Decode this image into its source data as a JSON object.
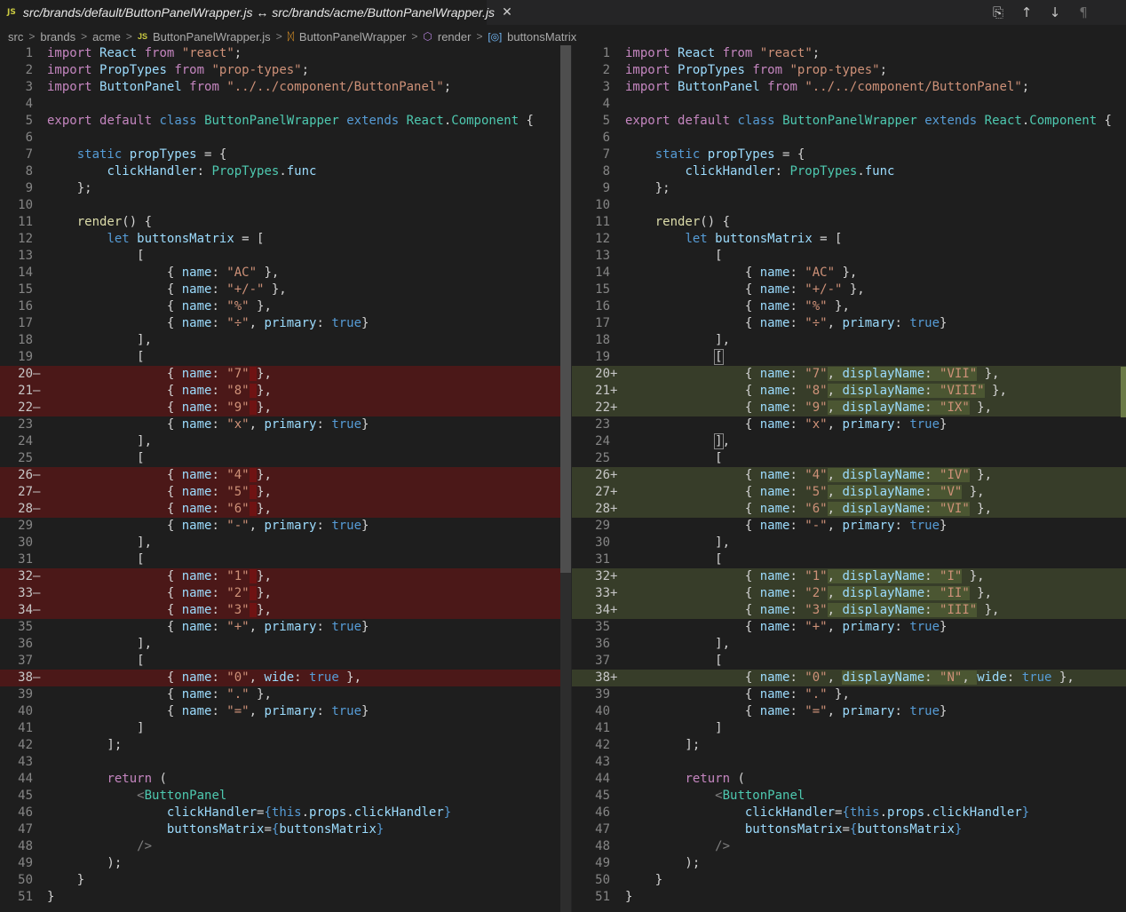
{
  "tab": {
    "badge": "JS",
    "title": "src/brands/default/ButtonPanelWrapper.js ↔ src/brands/acme/ButtonPanelWrapper.js",
    "close": "✕"
  },
  "actions": [
    {
      "name": "open-file-icon",
      "glyph": "⎘"
    },
    {
      "name": "previous-change-icon",
      "glyph": "↑"
    },
    {
      "name": "next-change-icon",
      "glyph": "↓"
    },
    {
      "name": "toggle-whitespace-icon",
      "glyph": "¶"
    },
    {
      "name": "more-actions-icon",
      "glyph": ""
    }
  ],
  "breadcrumb": {
    "src": "src",
    "brands": "brands",
    "acme": "acme",
    "file_badge": "JS",
    "file": "ButtonPanelWrapper.js",
    "class": "ButtonPanelWrapper",
    "method": "render",
    "variable": "buttonsMatrix",
    "sep": ">"
  },
  "left_lines": [
    {
      "n": "1",
      "m": "",
      "t": "",
      "h": "<span class='k'>import</span> <span class='v'>React</span> <span class='k'>from</span> <span class='s'>\"react\"</span>;"
    },
    {
      "n": "2",
      "m": "",
      "t": "",
      "h": "<span class='k'>import</span> <span class='v'>PropTypes</span> <span class='k'>from</span> <span class='s'>\"prop-types\"</span>;"
    },
    {
      "n": "3",
      "m": "",
      "t": "",
      "h": "<span class='k'>import</span> <span class='v'>ButtonPanel</span> <span class='k'>from</span> <span class='s'>\"../../component/ButtonPanel\"</span>;"
    },
    {
      "n": "4",
      "m": "",
      "t": "",
      "h": ""
    },
    {
      "n": "5",
      "m": "",
      "t": "",
      "h": "<span class='k'>export</span> <span class='k'>default</span> <span class='kb'>class</span> <span class='t'>ButtonPanelWrapper</span> <span class='kb'>extends</span> <span class='t'>React</span>.<span class='t'>Component</span> {"
    },
    {
      "n": "6",
      "m": "",
      "t": "",
      "h": ""
    },
    {
      "n": "7",
      "m": "",
      "t": "",
      "h": "    <span class='kb'>static</span> <span class='p'>propTypes</span> = {"
    },
    {
      "n": "8",
      "m": "",
      "t": "",
      "h": "        <span class='p'>clickHandler</span>: <span class='t'>PropTypes</span>.<span class='p'>func</span>"
    },
    {
      "n": "9",
      "m": "",
      "t": "",
      "h": "    };"
    },
    {
      "n": "10",
      "m": "",
      "t": "",
      "h": ""
    },
    {
      "n": "11",
      "m": "",
      "t": "",
      "h": "    <span class='f'>render</span>() {"
    },
    {
      "n": "12",
      "m": "",
      "t": "",
      "h": "        <span class='kb'>let</span> <span class='v'>buttonsMatrix</span> = ["
    },
    {
      "n": "13",
      "m": "",
      "t": "",
      "h": "            ["
    },
    {
      "n": "14",
      "m": "",
      "t": "",
      "h": "                { <span class='p'>name</span>: <span class='s'>\"AC\"</span> },"
    },
    {
      "n": "15",
      "m": "",
      "t": "",
      "h": "                { <span class='p'>name</span>: <span class='s'>\"+/-\"</span> },"
    },
    {
      "n": "16",
      "m": "",
      "t": "",
      "h": "                { <span class='p'>name</span>: <span class='s'>\"%\"</span> },"
    },
    {
      "n": "17",
      "m": "",
      "t": "",
      "h": "                { <span class='p'>name</span>: <span class='s'>\"÷\"</span>, <span class='p'>primary</span>: <span class='kb'>true</span>}"
    },
    {
      "n": "18",
      "m": "",
      "t": "",
      "h": "            ],"
    },
    {
      "n": "19",
      "m": "",
      "t": "",
      "h": "            ["
    },
    {
      "n": "20",
      "m": "—",
      "t": "del",
      "h": "                { <span class='p'>name</span>: <span class='s'>\"7\"</span><span class='hl-del'> </span>},"
    },
    {
      "n": "21",
      "m": "—",
      "t": "del",
      "h": "                { <span class='p'>name</span>: <span class='s'>\"8\"</span><span class='hl-del'> </span>},"
    },
    {
      "n": "22",
      "m": "—",
      "t": "del",
      "h": "                { <span class='p'>name</span>: <span class='s'>\"9\"</span><span class='hl-del'> </span>},"
    },
    {
      "n": "23",
      "m": "",
      "t": "",
      "h": "                { <span class='p'>name</span>: <span class='s'>\"x\"</span>, <span class='p'>primary</span>: <span class='kb'>true</span>}"
    },
    {
      "n": "24",
      "m": "",
      "t": "",
      "h": "            ],"
    },
    {
      "n": "25",
      "m": "",
      "t": "",
      "h": "            ["
    },
    {
      "n": "26",
      "m": "—",
      "t": "del",
      "h": "                { <span class='p'>name</span>: <span class='s'>\"4\"</span><span class='hl-del'> </span>},"
    },
    {
      "n": "27",
      "m": "—",
      "t": "del",
      "h": "                { <span class='p'>name</span>: <span class='s'>\"5\"</span><span class='hl-del'> </span>},"
    },
    {
      "n": "28",
      "m": "—",
      "t": "del",
      "h": "                { <span class='p'>name</span>: <span class='s'>\"6\"</span><span class='hl-del'> </span>},"
    },
    {
      "n": "29",
      "m": "",
      "t": "",
      "h": "                { <span class='p'>name</span>: <span class='s'>\"-\"</span>, <span class='p'>primary</span>: <span class='kb'>true</span>}"
    },
    {
      "n": "30",
      "m": "",
      "t": "",
      "h": "            ],"
    },
    {
      "n": "31",
      "m": "",
      "t": "",
      "h": "            ["
    },
    {
      "n": "32",
      "m": "—",
      "t": "del",
      "h": "                { <span class='p'>name</span>: <span class='s'>\"1\"</span><span class='hl-del'> </span>},"
    },
    {
      "n": "33",
      "m": "—",
      "t": "del",
      "h": "                { <span class='p'>name</span>: <span class='s'>\"2\"</span><span class='hl-del'> </span>},"
    },
    {
      "n": "34",
      "m": "—",
      "t": "del",
      "h": "                { <span class='p'>name</span>: <span class='s'>\"3\"</span><span class='hl-del'> </span>},"
    },
    {
      "n": "35",
      "m": "",
      "t": "",
      "h": "                { <span class='p'>name</span>: <span class='s'>\"+\"</span>, <span class='p'>primary</span>: <span class='kb'>true</span>}"
    },
    {
      "n": "36",
      "m": "",
      "t": "",
      "h": "            ],"
    },
    {
      "n": "37",
      "m": "",
      "t": "",
      "h": "            ["
    },
    {
      "n": "38",
      "m": "—",
      "t": "del",
      "h": "                { <span class='p'>name</span>: <span class='s'>\"0\"</span>, <span class='p'>wide</span>: <span class='kb'>true</span> },"
    },
    {
      "n": "39",
      "m": "",
      "t": "",
      "h": "                { <span class='p'>name</span>: <span class='s'>\".\"</span> },"
    },
    {
      "n": "40",
      "m": "",
      "t": "",
      "h": "                { <span class='p'>name</span>: <span class='s'>\"=\"</span>, <span class='p'>primary</span>: <span class='kb'>true</span>}"
    },
    {
      "n": "41",
      "m": "",
      "t": "",
      "h": "            ]"
    },
    {
      "n": "42",
      "m": "",
      "t": "",
      "h": "        ];"
    },
    {
      "n": "43",
      "m": "",
      "t": "",
      "h": ""
    },
    {
      "n": "44",
      "m": "",
      "t": "",
      "h": "        <span class='k'>return</span> ("
    },
    {
      "n": "45",
      "m": "",
      "t": "",
      "h": "            <span class='g'>&lt;</span><span class='t'>ButtonPanel</span>"
    },
    {
      "n": "46",
      "m": "",
      "t": "",
      "h": "                <span class='p'>clickHandler</span>=<span class='kb'>{</span><span class='kb'>this</span>.<span class='p'>props</span>.<span class='p'>clickHandler</span><span class='kb'>}</span>"
    },
    {
      "n": "47",
      "m": "",
      "t": "",
      "h": "                <span class='p'>buttonsMatrix</span>=<span class='kb'>{</span><span class='v'>buttonsMatrix</span><span class='kb'>}</span>"
    },
    {
      "n": "48",
      "m": "",
      "t": "",
      "h": "            <span class='g'>/&gt;</span>"
    },
    {
      "n": "49",
      "m": "",
      "t": "",
      "h": "        );"
    },
    {
      "n": "50",
      "m": "",
      "t": "",
      "h": "    }"
    },
    {
      "n": "51",
      "m": "",
      "t": "",
      "h": "}"
    }
  ],
  "right_lines": [
    {
      "n": "1",
      "m": "",
      "t": "",
      "h": "<span class='k'>import</span> <span class='v'>React</span> <span class='k'>from</span> <span class='s'>\"react\"</span>;"
    },
    {
      "n": "2",
      "m": "",
      "t": "",
      "h": "<span class='k'>import</span> <span class='v'>PropTypes</span> <span class='k'>from</span> <span class='s'>\"prop-types\"</span>;"
    },
    {
      "n": "3",
      "m": "",
      "t": "",
      "h": "<span class='k'>import</span> <span class='v'>ButtonPanel</span> <span class='k'>from</span> <span class='s'>\"../../component/ButtonPanel\"</span>;"
    },
    {
      "n": "4",
      "m": "",
      "t": "",
      "h": ""
    },
    {
      "n": "5",
      "m": "",
      "t": "",
      "h": "<span class='k'>export</span> <span class='k'>default</span> <span class='kb'>class</span> <span class='t'>ButtonPanelWrapper</span> <span class='kb'>extends</span> <span class='t'>React</span>.<span class='t'>Component</span> {"
    },
    {
      "n": "6",
      "m": "",
      "t": "",
      "h": ""
    },
    {
      "n": "7",
      "m": "",
      "t": "",
      "h": "    <span class='kb'>static</span> <span class='p'>propTypes</span> = {"
    },
    {
      "n": "8",
      "m": "",
      "t": "",
      "h": "        <span class='p'>clickHandler</span>: <span class='t'>PropTypes</span>.<span class='p'>func</span>"
    },
    {
      "n": "9",
      "m": "",
      "t": "",
      "h": "    };"
    },
    {
      "n": "10",
      "m": "",
      "t": "",
      "h": ""
    },
    {
      "n": "11",
      "m": "",
      "t": "",
      "h": "    <span class='f'>render</span>() {"
    },
    {
      "n": "12",
      "m": "",
      "t": "",
      "h": "        <span class='kb'>let</span> <span class='v'>buttonsMatrix</span> = ["
    },
    {
      "n": "13",
      "m": "",
      "t": "",
      "h": "            ["
    },
    {
      "n": "14",
      "m": "",
      "t": "",
      "h": "                { <span class='p'>name</span>: <span class='s'>\"AC\"</span> },"
    },
    {
      "n": "15",
      "m": "",
      "t": "",
      "h": "                { <span class='p'>name</span>: <span class='s'>\"+/-\"</span> },"
    },
    {
      "n": "16",
      "m": "",
      "t": "",
      "h": "                { <span class='p'>name</span>: <span class='s'>\"%\"</span> },"
    },
    {
      "n": "17",
      "m": "",
      "t": "",
      "h": "                { <span class='p'>name</span>: <span class='s'>\"÷\"</span>, <span class='p'>primary</span>: <span class='kb'>true</span>}"
    },
    {
      "n": "18",
      "m": "",
      "t": "",
      "h": "            ],"
    },
    {
      "n": "19",
      "m": "",
      "t": "",
      "h": "            <span class='bk'>[</span>"
    },
    {
      "n": "20",
      "m": "+",
      "t": "ins",
      "h": "                { <span class='p'>name</span>: <span class='s'>\"7\"</span><span class='hl-ins'>, <span class='p'>displayName</span>: <span class='s'>\"VII\"</span></span> },"
    },
    {
      "n": "21",
      "m": "+",
      "t": "ins",
      "h": "                { <span class='p'>name</span>: <span class='s'>\"8\"</span><span class='hl-ins'>, <span class='p'>displayName</span>: <span class='s'>\"VIII\"</span></span> },"
    },
    {
      "n": "22",
      "m": "+",
      "t": "ins",
      "h": "                { <span class='p'>name</span>: <span class='s'>\"9\"</span><span class='hl-ins'>, <span class='p'>displayName</span>: <span class='s'>\"IX\"</span></span> },"
    },
    {
      "n": "23",
      "m": "",
      "t": "",
      "h": "                { <span class='p'>name</span>: <span class='s'>\"x\"</span>, <span class='p'>primary</span>: <span class='kb'>true</span>}"
    },
    {
      "n": "24",
      "m": "",
      "t": "",
      "h": "            <span class='bk'>]</span>,"
    },
    {
      "n": "25",
      "m": "",
      "t": "",
      "h": "            ["
    },
    {
      "n": "26",
      "m": "+",
      "t": "ins",
      "h": "                { <span class='p'>name</span>: <span class='s'>\"4\"</span><span class='hl-ins'>, <span class='p'>displayName</span>: <span class='s'>\"IV\"</span></span> },"
    },
    {
      "n": "27",
      "m": "+",
      "t": "ins",
      "h": "                { <span class='p'>name</span>: <span class='s'>\"5\"</span><span class='hl-ins'>, <span class='p'>displayName</span>: <span class='s'>\"V\"</span></span> },"
    },
    {
      "n": "28",
      "m": "+",
      "t": "ins",
      "h": "                { <span class='p'>name</span>: <span class='s'>\"6\"</span><span class='hl-ins'>, <span class='p'>displayName</span>: <span class='s'>\"VI\"</span></span> },"
    },
    {
      "n": "29",
      "m": "",
      "t": "",
      "h": "                { <span class='p'>name</span>: <span class='s'>\"-\"</span>, <span class='p'>primary</span>: <span class='kb'>true</span>}"
    },
    {
      "n": "30",
      "m": "",
      "t": "",
      "h": "            ],"
    },
    {
      "n": "31",
      "m": "",
      "t": "",
      "h": "            ["
    },
    {
      "n": "32",
      "m": "+",
      "t": "ins",
      "h": "                { <span class='p'>name</span>: <span class='s'>\"1\"</span><span class='hl-ins'>, <span class='p'>displayName</span>: <span class='s'>\"I\"</span></span> },"
    },
    {
      "n": "33",
      "m": "+",
      "t": "ins",
      "h": "                { <span class='p'>name</span>: <span class='s'>\"2\"</span><span class='hl-ins'>, <span class='p'>displayName</span>: <span class='s'>\"II\"</span></span> },"
    },
    {
      "n": "34",
      "m": "+",
      "t": "ins",
      "h": "                { <span class='p'>name</span>: <span class='s'>\"3\"</span><span class='hl-ins'>, <span class='p'>displayName</span>: <span class='s'>\"III\"</span></span> },"
    },
    {
      "n": "35",
      "m": "",
      "t": "",
      "h": "                { <span class='p'>name</span>: <span class='s'>\"+\"</span>, <span class='p'>primary</span>: <span class='kb'>true</span>}"
    },
    {
      "n": "36",
      "m": "",
      "t": "",
      "h": "            ],"
    },
    {
      "n": "37",
      "m": "",
      "t": "",
      "h": "            ["
    },
    {
      "n": "38",
      "m": "+",
      "t": "ins",
      "h": "                { <span class='p'>name</span>: <span class='s'>\"0\"</span>, <span class='hl-ins'><span class='p'>displayName</span>: <span class='s'>\"N\"</span>, </span><span class='p'>wide</span>: <span class='kb'>true</span> },"
    },
    {
      "n": "39",
      "m": "",
      "t": "",
      "h": "                { <span class='p'>name</span>: <span class='s'>\".\"</span> },"
    },
    {
      "n": "40",
      "m": "",
      "t": "",
      "h": "                { <span class='p'>name</span>: <span class='s'>\"=\"</span>, <span class='p'>primary</span>: <span class='kb'>true</span>}"
    },
    {
      "n": "41",
      "m": "",
      "t": "",
      "h": "            ]"
    },
    {
      "n": "42",
      "m": "",
      "t": "",
      "h": "        ];"
    },
    {
      "n": "43",
      "m": "",
      "t": "",
      "h": ""
    },
    {
      "n": "44",
      "m": "",
      "t": "",
      "h": "        <span class='k'>return</span> ("
    },
    {
      "n": "45",
      "m": "",
      "t": "",
      "h": "            <span class='g'>&lt;</span><span class='t'>ButtonPanel</span>"
    },
    {
      "n": "46",
      "m": "",
      "t": "",
      "h": "                <span class='p'>clickHandler</span>=<span class='kb'>{</span><span class='kb'>this</span>.<span class='p'>props</span>.<span class='p'>clickHandler</span><span class='kb'>}</span>"
    },
    {
      "n": "47",
      "m": "",
      "t": "",
      "h": "                <span class='p'>buttonsMatrix</span>=<span class='kb'>{</span><span class='v'>buttonsMatrix</span><span class='kb'>}</span>"
    },
    {
      "n": "48",
      "m": "",
      "t": "",
      "h": "            <span class='g'>/&gt;</span>"
    },
    {
      "n": "49",
      "m": "",
      "t": "",
      "h": "        );"
    },
    {
      "n": "50",
      "m": "",
      "t": "",
      "h": "    }"
    },
    {
      "n": "51",
      "m": "",
      "t": "",
      "h": "}"
    }
  ]
}
